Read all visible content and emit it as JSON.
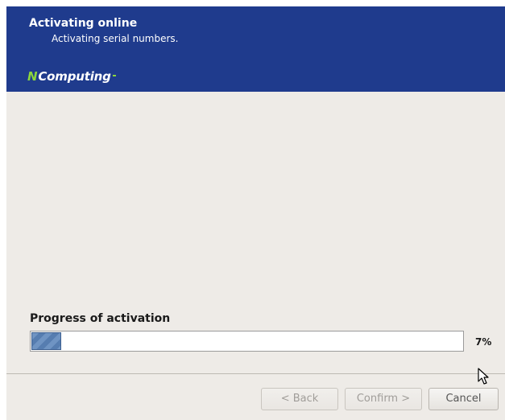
{
  "header": {
    "title": "Activating online",
    "subtitle": "Activating serial numbers.",
    "logo_mark": "N",
    "logo_text": "Computing",
    "background_color": "#1f3b8d",
    "logo_accent_color": "#8cd63d"
  },
  "progress": {
    "label": "Progress of activation",
    "value_percent": 7,
    "percent_text": "7%",
    "fill_color": "#5b85bb"
  },
  "buttons": {
    "back_label": "< Back",
    "confirm_label": "Confirm >",
    "cancel_label": "Cancel"
  },
  "cursor": {
    "icon": "arrow-pointer-icon"
  }
}
